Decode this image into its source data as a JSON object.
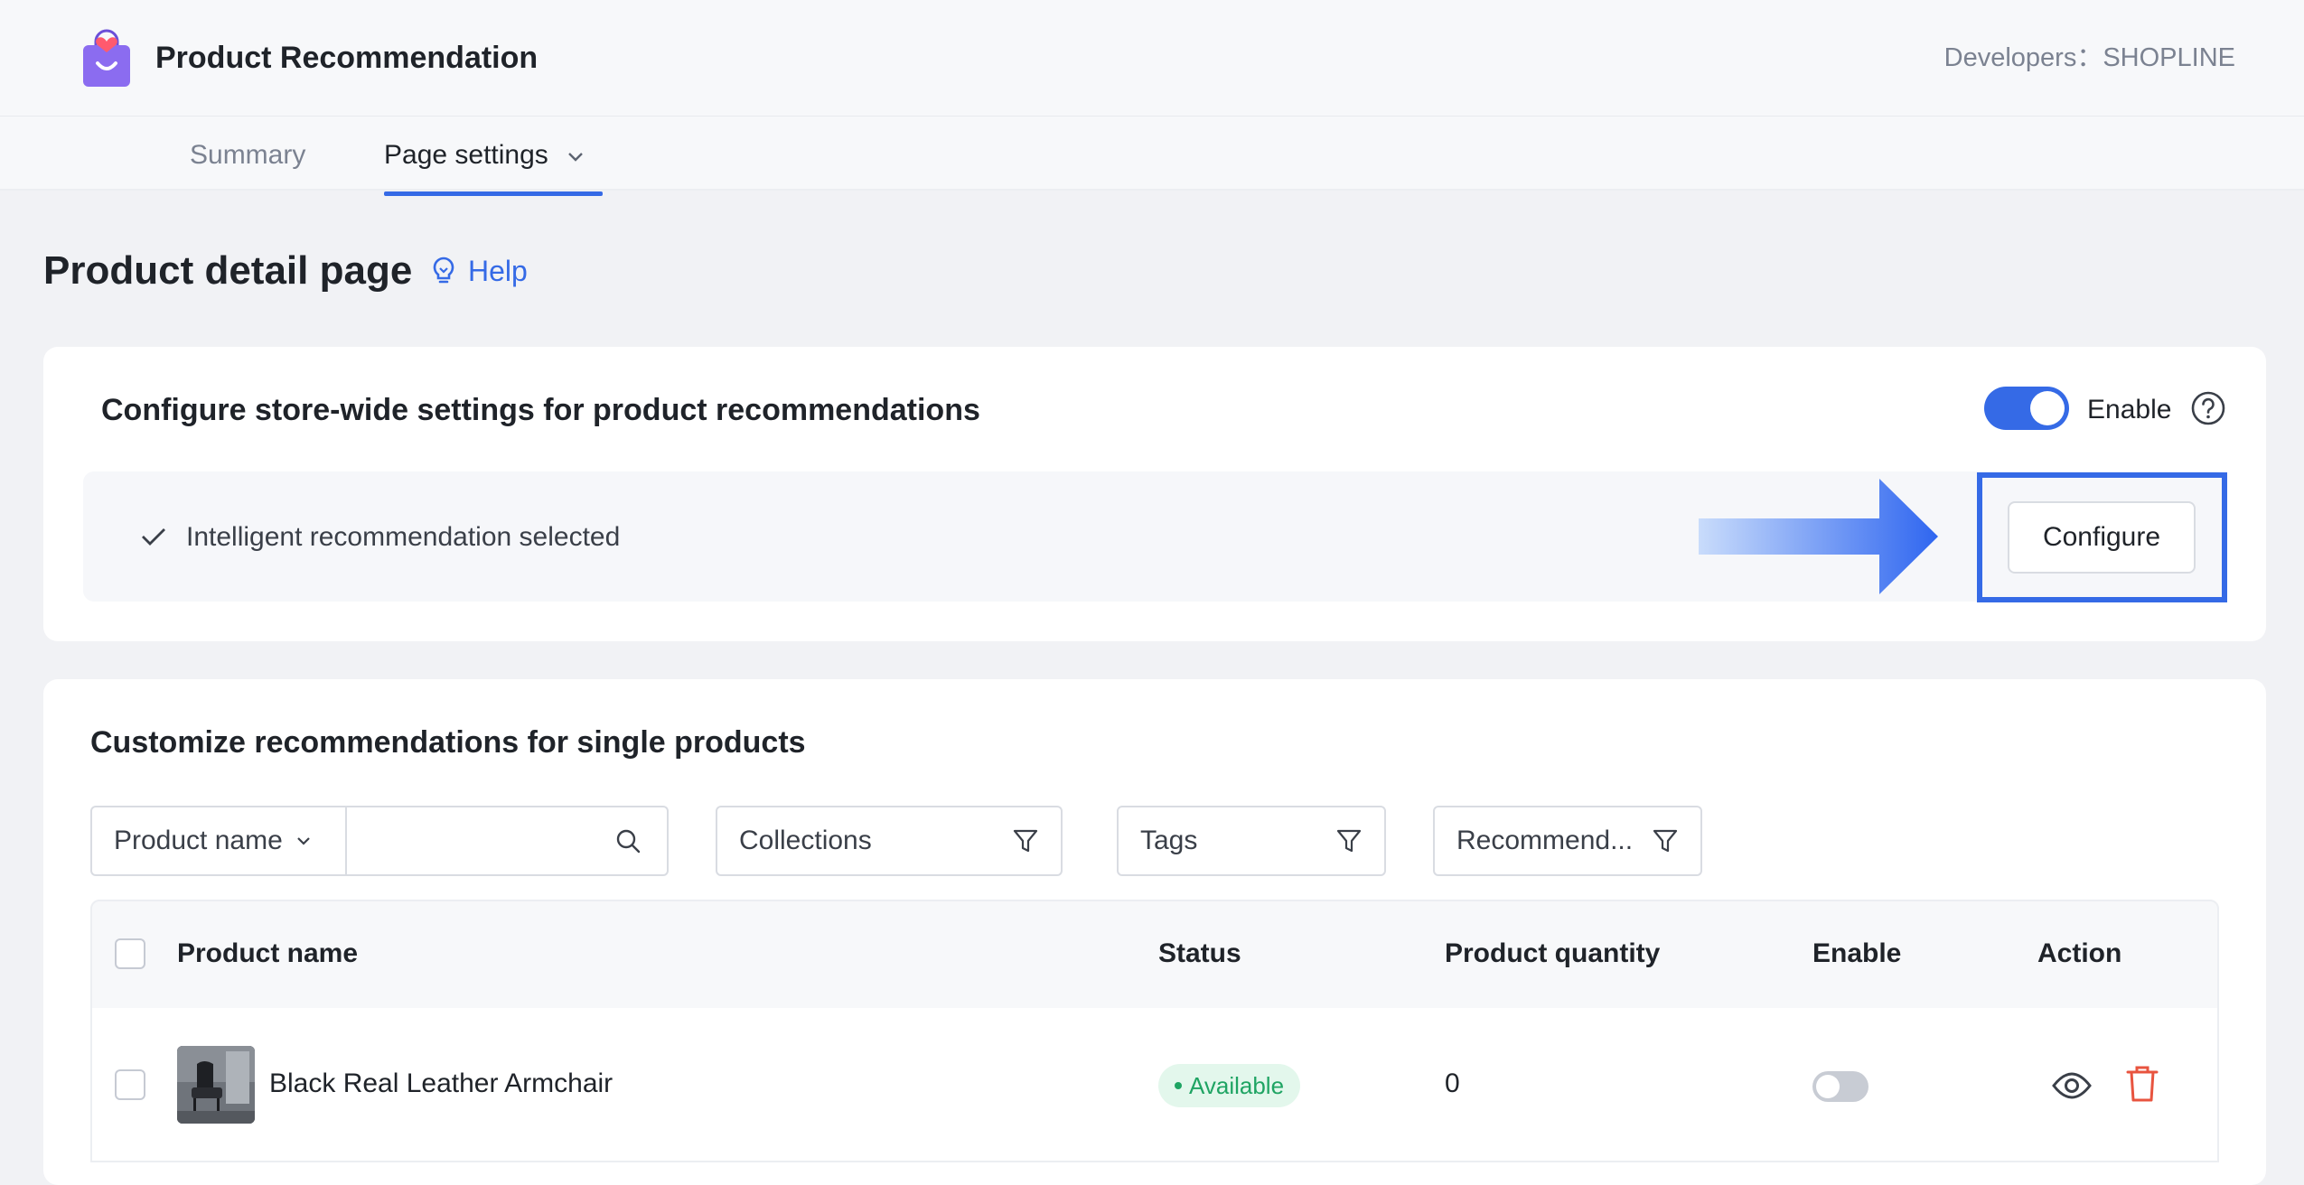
{
  "header": {
    "app_title": "Product Recommendation",
    "developer": "Developers：SHOPLINE"
  },
  "tabs": [
    {
      "label": "Summary",
      "active": false
    },
    {
      "label": "Page settings",
      "active": true
    }
  ],
  "page": {
    "title": "Product detail page",
    "help_label": "Help"
  },
  "store_wide": {
    "title": "Configure store-wide settings for product recommendations",
    "enable_label": "Enable",
    "enabled": true,
    "selected_text": "Intelligent recommendation selected",
    "configure_label": "Configure"
  },
  "single_products": {
    "title": "Customize recommendations for single products",
    "filters": {
      "field_select": "Product name",
      "search_value": "",
      "collections": "Collections",
      "tags": "Tags",
      "recommend": "Recommend..."
    },
    "columns": [
      "Product name",
      "Status",
      "Product quantity",
      "Enable",
      "Action"
    ],
    "rows": [
      {
        "name": "Black Real Leather Armchair",
        "status": "Available",
        "quantity": "0",
        "enabled": false
      }
    ]
  },
  "colors": {
    "accent": "#356ae6",
    "status_available": "#1fa463",
    "delete": "#e8543f"
  }
}
